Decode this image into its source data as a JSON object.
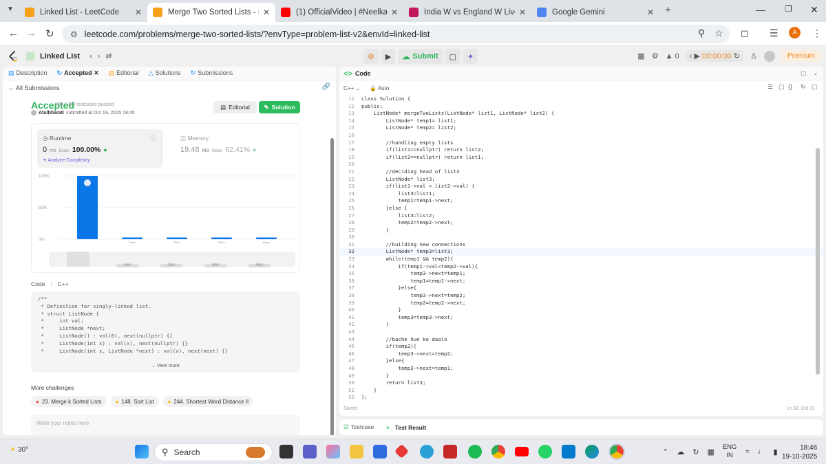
{
  "browser": {
    "tabs": [
      {
        "title": "Linked List - LeetCode",
        "color": "#f89f1b",
        "active": false
      },
      {
        "title": "Merge Two Sorted Lists - LeetC",
        "color": "#f89f1b",
        "active": true
      },
      {
        "title": "(1) OfficialVideo | #Neelkam",
        "color": "#ff0000",
        "active": false
      },
      {
        "title": "India W vs England W Live vide",
        "color": "#c2185b",
        "active": false
      },
      {
        "title": "Google Gemini",
        "color": "#4e86f6",
        "active": false
      }
    ],
    "url": "leetcode.com/problems/merge-two-sorted-lists/?envType=problem-list-v2&envId=linked-list",
    "profile_initial": "A"
  },
  "lc_header": {
    "problem_list": "Linked List",
    "submit_label": "Submit",
    "streak": "0",
    "timer": "00:00:00",
    "premium_label": "Premium"
  },
  "left_panel": {
    "tabs": [
      "Description",
      "Accepted",
      "Editorial",
      "Solutions",
      "Submissions"
    ],
    "active_tab": "Accepted",
    "back_label": "All Submissions",
    "status": "Accepted",
    "testcases": "208 / 208 testcases passed",
    "author": "Atulbharati",
    "submitted": "submitted at Oct 19, 2025 18:45",
    "editorial_btn": "Editorial",
    "solution_btn": "Solution",
    "runtime": {
      "label": "Runtime",
      "value": "0",
      "unit": "ms",
      "beats_label": "Beats",
      "beats": "100.00%"
    },
    "memory": {
      "label": "Memory",
      "value": "19.48",
      "unit": "MB",
      "beats_label": "Beats",
      "beats": "62.41%"
    },
    "analyze_label": "Analyze Complexity",
    "code_label": "Code",
    "code_lang": "C++",
    "code_preview": [
      "/**",
      " * Definition for singly-linked list.",
      " * struct ListNode {",
      " *     int val;",
      " *     ListNode *next;",
      " *     ListNode() : val(0), next(nullptr) {}",
      " *     ListNode(int x) : val(x), next(nullptr) {}",
      " *     ListNode(int x, ListNode *next) : val(x), next(next) {}"
    ],
    "view_more": "View more",
    "more_challenges_label": "More challenges",
    "challenges": [
      {
        "label": "23. Merge k Sorted Lists",
        "difficulty": "hard"
      },
      {
        "label": "148. Sort List",
        "difficulty": "medium"
      },
      {
        "label": "244. Shortest Word Distance II",
        "difficulty": "medium"
      }
    ],
    "notes_placeholder": "Write your notes here"
  },
  "chart_data": {
    "type": "bar",
    "categories": [
      "0ms",
      "1ms",
      "2ms",
      "3ms",
      "4ms"
    ],
    "tick_labels": [
      "",
      "1ms",
      "2ms",
      "3ms",
      "4ms"
    ],
    "values": [
      100,
      2,
      2,
      2,
      2
    ],
    "y_ticks": [
      "100%",
      "50%",
      "0%"
    ],
    "ylim": [
      0,
      100
    ],
    "bar_color": "#0a76e8",
    "highlight_index": 0,
    "range_labels": [
      "1ms",
      "2ms",
      "3ms",
      "4ms"
    ]
  },
  "code_panel": {
    "title": "Code",
    "lang": "C++",
    "mode": "Auto",
    "current_line": 32,
    "start_line": 11,
    "lines": [
      "class Solution {",
      "public:",
      "    ListNode* mergeTwoLists(ListNode* list1, ListNode* list2) {",
      "        ListNode* temp1= list1;",
      "        ListNode* temp2= list2;",
      "",
      "        //handling empty lists",
      "        if(list1==nullptr) return list2;",
      "        if(list2==nullptr) return list1;",
      "",
      "        //deciding head of list3",
      "        ListNode* list3;",
      "        if(list1->val < list2->val) {",
      "            list3=list1;",
      "            temp1=temp1->next;",
      "        }else {",
      "            list3=list2;",
      "            temp2=temp2->next;",
      "        }",
      "",
      "        //building new connections",
      "        ListNode* temp3=list3;",
      "        while(temp1 && temp2){",
      "            if(temp1->val<temp2->val){",
      "                temp3->next=temp1;",
      "                temp1=temp1->next;",
      "            }else{",
      "                temp3->next=temp2;",
      "                temp2=temp2->next;",
      "            }",
      "            temp3=temp3->next;",
      "        }",
      "",
      "        //bache hue ko daalo",
      "        if(temp2){",
      "            temp3->next=temp2;",
      "        }else{",
      "            temp3->next=temp1;",
      "        }",
      "        return list3;",
      "    }",
      "};"
    ],
    "saved_label": "Saved",
    "cursor_pos": "Ln 32, Col 31"
  },
  "bottom_panel": {
    "testcase_label": "Testcase",
    "result_label": "Test Result"
  },
  "taskbar": {
    "temperature": "30°",
    "search_placeholder": "Search",
    "lang": "ENG",
    "region": "IN",
    "time": "18:46",
    "date": "19-10-2025"
  },
  "colors": {
    "accent_green": "#2db55d",
    "accent_blue": "#0a76e8",
    "premium_orange": "#f08b2b"
  }
}
